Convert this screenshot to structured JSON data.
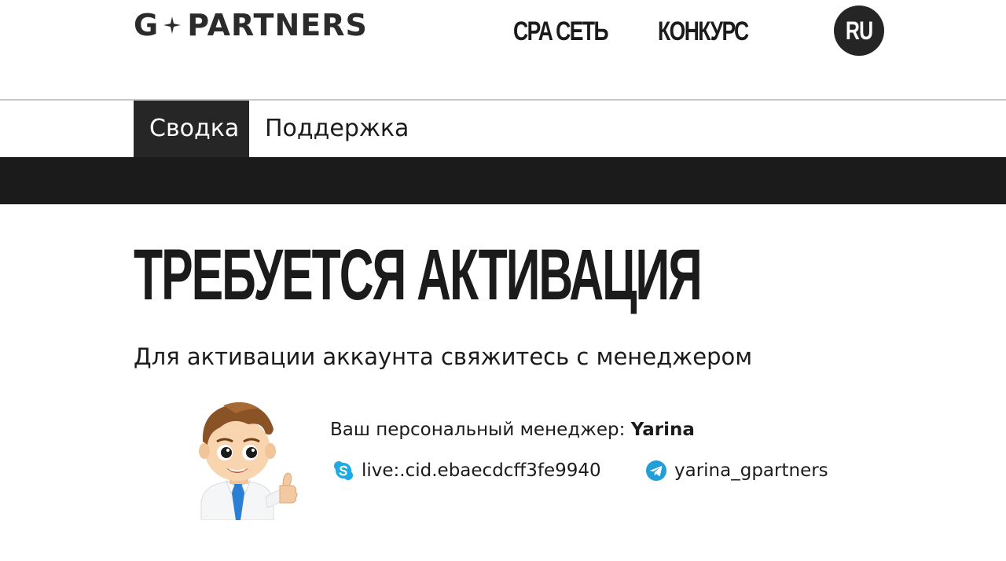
{
  "header": {
    "logo_left": "G",
    "logo_right": "PARTNERS",
    "nav": {
      "cpa_label": "CPA СЕТЬ",
      "contest_label": "КОНКУРС"
    },
    "language": "RU"
  },
  "subnav": {
    "tabs": [
      {
        "label": "Сводка",
        "active": true
      },
      {
        "label": "Поддержка",
        "active": false
      }
    ]
  },
  "main": {
    "title": "ТРЕБУЕТСЯ АКТИВАЦИЯ",
    "subtitle": "Для активации аккаунта свяжитесь с менеджером",
    "manager": {
      "label": "Ваш персональный менеджер:",
      "name": "Yarina",
      "skype_icon": "skype-icon",
      "skype": "live:.cid.ebaecdcff3fe9940",
      "telegram_icon": "telegram-icon",
      "telegram": "yarina_gpartners"
    }
  },
  "colors": {
    "dark": "#1b1b1b",
    "tab_active_bg": "#262626",
    "skype_blue": "#1eaae3",
    "telegram_blue": "#229ed9",
    "tie_blue": "#2a7fd4"
  }
}
